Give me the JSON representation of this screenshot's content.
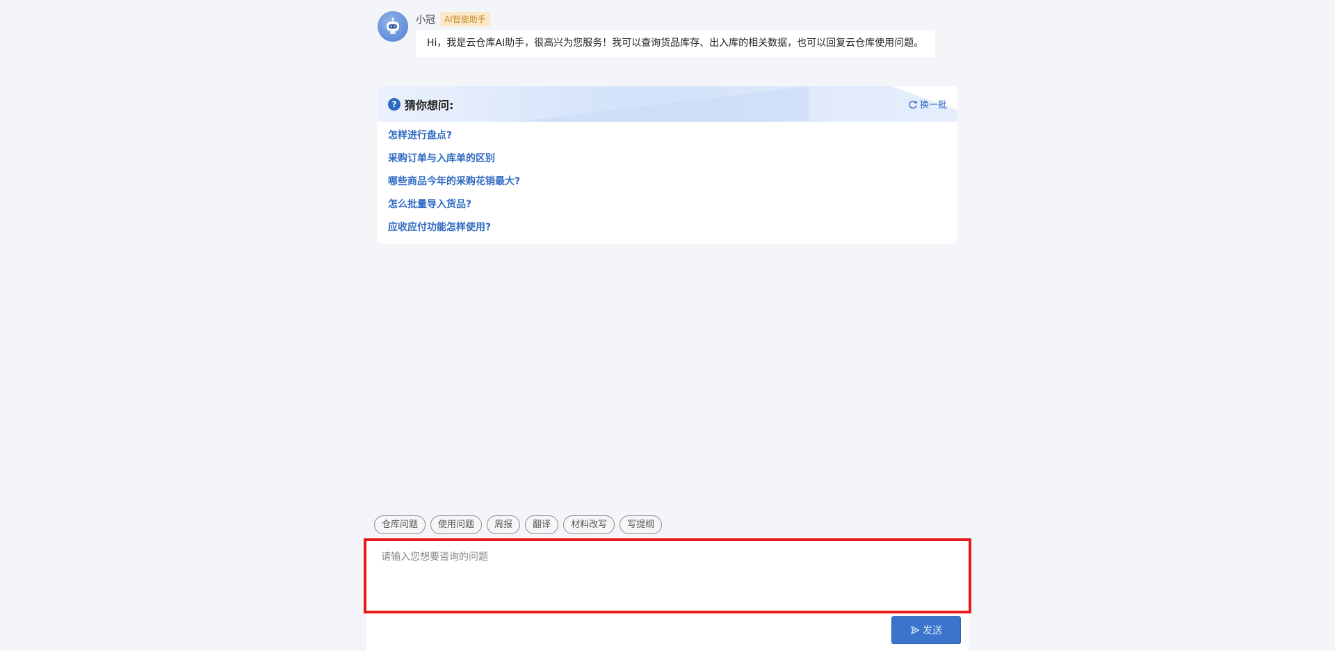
{
  "assistant": {
    "name": "小冠",
    "tag": "AI智能助手",
    "avatar_icon": "robot-icon",
    "greeting": "Hi，我是云仓库AI助手，很高兴为您服务！我可以查询货品库存、出入库的相关数据，也可以回复云仓库使用问题。"
  },
  "suggestions": {
    "title": "猜你想问:",
    "refresh_label": "换一批",
    "items": [
      "怎样进行盘点?",
      "采购订单与入库单的区别",
      "哪些商品今年的采购花销最大?",
      "怎么批量导入货品?",
      "应收应付功能怎样使用?"
    ]
  },
  "chips": [
    "仓库问题",
    "使用问题",
    "周报",
    "翻译",
    "材料改写",
    "写提纲"
  ],
  "input": {
    "placeholder": "请输入您想要咨询的问题",
    "value": ""
  },
  "send_label": "发送",
  "colors": {
    "accent": "#2f6ac2",
    "send_button": "#3a75cb",
    "highlight": "#e51a1a",
    "tag_bg": "#fbe9c9",
    "tag_text": "#c98a2a"
  }
}
